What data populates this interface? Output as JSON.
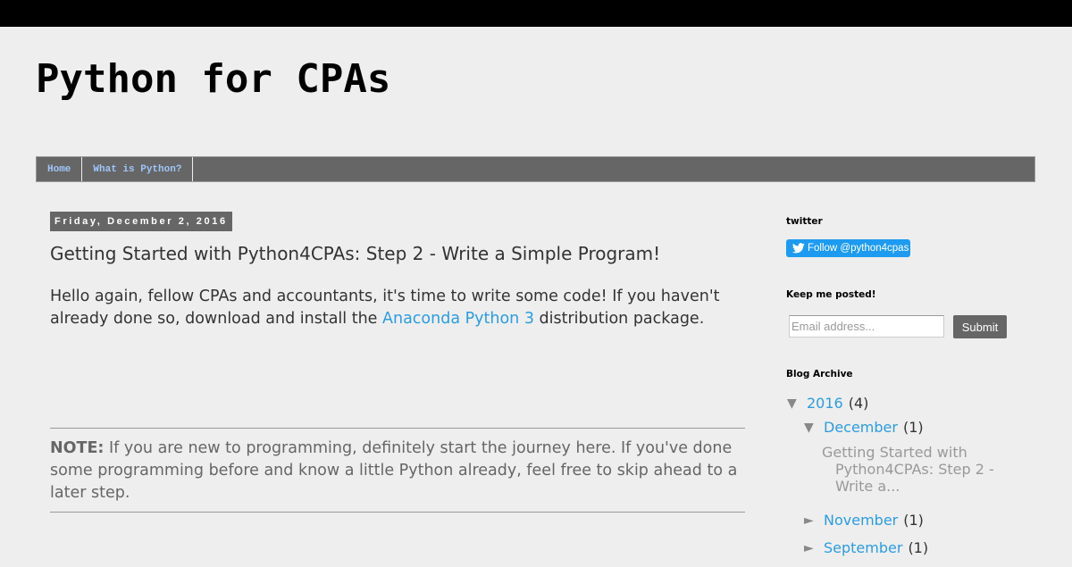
{
  "blog": {
    "title": "Python for CPAs"
  },
  "nav": {
    "tabs": [
      {
        "label": "Home"
      },
      {
        "label": "What is Python?"
      }
    ]
  },
  "post": {
    "date": "Friday, December 2, 2016",
    "title": "Getting Started with Python4CPAs: Step 2 - Write a Simple Program!",
    "intro_before_link": "Hello again, fellow CPAs and accountants, it's time to write some code! If you haven't already done so, download and install the ",
    "link_text": "Anaconda Python 3",
    "intro_after_link": " distribution package.",
    "note_label": "NOTE:",
    "note_text": " If you are new to programming, definitely start the journey here. If you've done some programming before and know a little Python already, feel free to skip ahead to a later step."
  },
  "sidebar": {
    "twitter": {
      "title": "twitter",
      "button_label": "Follow @python4cpas"
    },
    "subscribe": {
      "title": "Keep me posted!",
      "placeholder": "Email address...",
      "submit_label": "Submit"
    },
    "archive": {
      "title": "Blog Archive",
      "year": {
        "label": "2016",
        "count": "(4)",
        "toggle": "▼"
      },
      "months": [
        {
          "label": "December",
          "count": "(1)",
          "toggle": "▼"
        },
        {
          "label": "November",
          "count": "(1)",
          "toggle": "►"
        },
        {
          "label": "September",
          "count": "(1)",
          "toggle": "►"
        }
      ],
      "post_lines": [
        "Getting Started with",
        "Python4CPAs: Step 2 -",
        "Write a..."
      ]
    }
  },
  "colors": {
    "link": "#2a9de0",
    "nav_bg": "#666666",
    "twitter": "#1d9bf0"
  }
}
